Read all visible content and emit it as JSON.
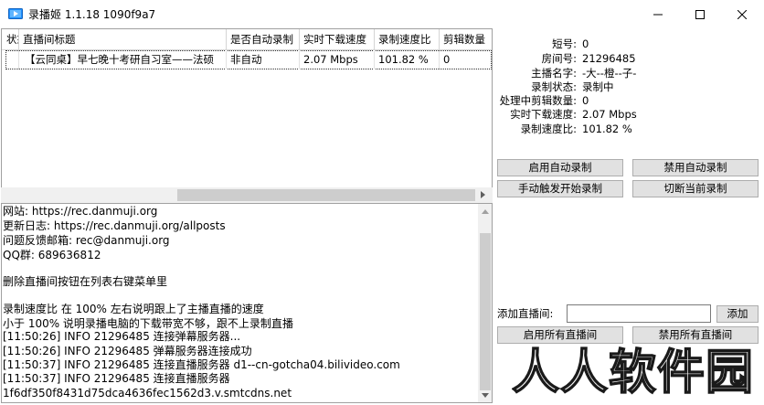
{
  "window": {
    "title": "录播姬 1.1.18 1090f9a7"
  },
  "grid": {
    "columns": [
      "状态",
      "直播间标题",
      "是否自动录制",
      "实时下载速度",
      "录制速度比",
      "剪辑数量"
    ],
    "rows": [
      {
        "status": "",
        "title": "【云同桌】早七晚十考研自习室——法硕",
        "auto": "非自动",
        "speed": "2.07 Mbps",
        "ratio": "101.82 %",
        "clips": "0"
      }
    ]
  },
  "log": {
    "lines": [
      "网站:   https://rec.danmuji.org",
      "更新日志:   https://rec.danmuji.org/allposts",
      "问题反馈邮箱:   rec@danmuji.org",
      "QQ群:   689636812",
      "",
      "删除直播间按钮在列表右键菜单里",
      "",
      "录制速度比 在 100% 左右说明跟上了主播直播的速度",
      "小于 100% 说明录播电脑的下载带宽不够，跟不上录制直播",
      "[11:50:26] INFO 21296485 连接弹幕服务器...",
      "[11:50:26] INFO 21296485 弹幕服务器连接成功",
      "[11:50:37] INFO 21296485 连接直播服务器 d1--cn-gotcha04.bilivideo.com",
      "[11:50:37] INFO 21296485 连接直播服务器",
      "1f6df350f8431d75dca4636fec1562d3.v.smtcdns.net"
    ]
  },
  "info": {
    "short_id_label": "短号:",
    "short_id": "0",
    "room_id_label": "房间号:",
    "room_id": "21296485",
    "streamer_label": "主播名字:",
    "streamer": "-大--橙--子-",
    "rec_status_label": "录制状态:",
    "rec_status": "录制中",
    "clips_processing_label": "处理中剪辑数量:",
    "clips_processing": "0",
    "download_speed_label": "实时下载速度:",
    "download_speed": "2.07 Mbps",
    "rec_ratio_label": "录制速度比:",
    "rec_ratio": "101.82 %"
  },
  "buttons": {
    "enable_auto": "启用自动录制",
    "disable_auto": "禁用自动录制",
    "manual_start": "手动触发开始录制",
    "cut_current": "切断当前录制",
    "add_room_label": "添加直播间:",
    "add_room_value": "",
    "add": "添加",
    "enable_all": "启用所有直播间",
    "disable_all": "禁用所有直播间"
  },
  "watermark": {
    "text": "人人软件园"
  }
}
